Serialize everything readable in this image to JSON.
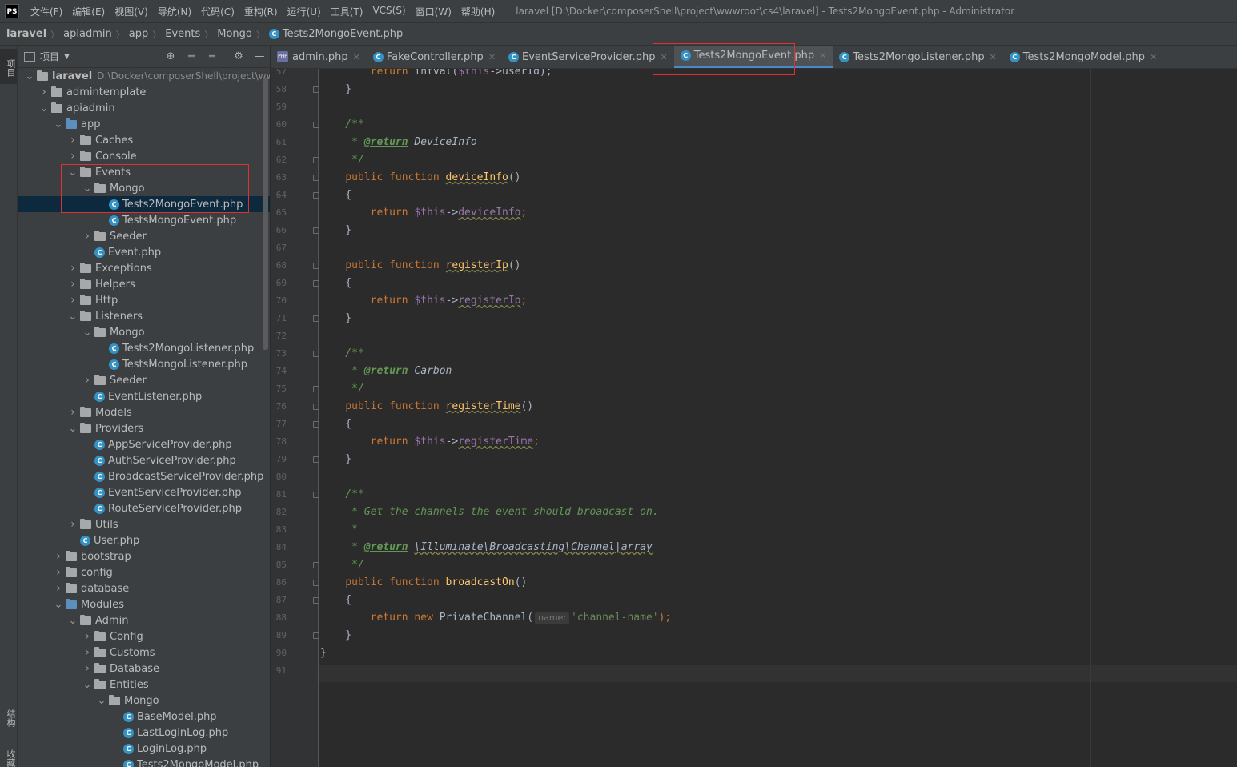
{
  "menubar": {
    "logo": "PS",
    "items": [
      "文件(F)",
      "编辑(E)",
      "视图(V)",
      "导航(N)",
      "代码(C)",
      "重构(R)",
      "运行(U)",
      "工具(T)",
      "VCS(S)",
      "窗口(W)",
      "帮助(H)"
    ],
    "window_title": "laravel [D:\\Docker\\composerShell\\project\\wwwroot\\cs4\\laravel] - Tests2MongoEvent.php - Administrator"
  },
  "breadcrumb": [
    "laravel",
    "apiadmin",
    "app",
    "Events",
    "Mongo",
    "Tests2MongoEvent.php"
  ],
  "left_strip": {
    "project_tab": "项目",
    "structure_tab": "结构",
    "favorites_tab": "收藏"
  },
  "project_panel": {
    "title": "项目",
    "root_hint": "D:\\Docker\\composerShell\\project\\wwwroot",
    "tree": [
      {
        "label": "laravel",
        "depth": 0,
        "type": "folder",
        "expanded": true,
        "bold": true
      },
      {
        "label": "admintemplate",
        "depth": 1,
        "type": "folder",
        "expanded": false
      },
      {
        "label": "apiadmin",
        "depth": 1,
        "type": "folder",
        "expanded": true
      },
      {
        "label": "app",
        "depth": 2,
        "type": "folder-blue",
        "expanded": true
      },
      {
        "label": "Caches",
        "depth": 3,
        "type": "folder",
        "expanded": false
      },
      {
        "label": "Console",
        "depth": 3,
        "type": "folder",
        "expanded": false
      },
      {
        "label": "Events",
        "depth": 3,
        "type": "folder",
        "expanded": true
      },
      {
        "label": "Mongo",
        "depth": 4,
        "type": "folder",
        "expanded": true
      },
      {
        "label": "Tests2MongoEvent.php",
        "depth": 5,
        "type": "class",
        "selected": true
      },
      {
        "label": "TestsMongoEvent.php",
        "depth": 5,
        "type": "class"
      },
      {
        "label": "Seeder",
        "depth": 4,
        "type": "folder",
        "expanded": false
      },
      {
        "label": "Event.php",
        "depth": 4,
        "type": "class"
      },
      {
        "label": "Exceptions",
        "depth": 3,
        "type": "folder",
        "expanded": false
      },
      {
        "label": "Helpers",
        "depth": 3,
        "type": "folder",
        "expanded": false
      },
      {
        "label": "Http",
        "depth": 3,
        "type": "folder",
        "expanded": false
      },
      {
        "label": "Listeners",
        "depth": 3,
        "type": "folder",
        "expanded": true
      },
      {
        "label": "Mongo",
        "depth": 4,
        "type": "folder",
        "expanded": true
      },
      {
        "label": "Tests2MongoListener.php",
        "depth": 5,
        "type": "class"
      },
      {
        "label": "TestsMongoListener.php",
        "depth": 5,
        "type": "class"
      },
      {
        "label": "Seeder",
        "depth": 4,
        "type": "folder",
        "expanded": false
      },
      {
        "label": "EventListener.php",
        "depth": 4,
        "type": "class"
      },
      {
        "label": "Models",
        "depth": 3,
        "type": "folder",
        "expanded": false
      },
      {
        "label": "Providers",
        "depth": 3,
        "type": "folder",
        "expanded": true
      },
      {
        "label": "AppServiceProvider.php",
        "depth": 4,
        "type": "class"
      },
      {
        "label": "AuthServiceProvider.php",
        "depth": 4,
        "type": "class"
      },
      {
        "label": "BroadcastServiceProvider.php",
        "depth": 4,
        "type": "class"
      },
      {
        "label": "EventServiceProvider.php",
        "depth": 4,
        "type": "class"
      },
      {
        "label": "RouteServiceProvider.php",
        "depth": 4,
        "type": "class"
      },
      {
        "label": "Utils",
        "depth": 3,
        "type": "folder",
        "expanded": false
      },
      {
        "label": "User.php",
        "depth": 3,
        "type": "class"
      },
      {
        "label": "bootstrap",
        "depth": 2,
        "type": "folder",
        "expanded": false
      },
      {
        "label": "config",
        "depth": 2,
        "type": "folder",
        "expanded": false
      },
      {
        "label": "database",
        "depth": 2,
        "type": "folder",
        "expanded": false
      },
      {
        "label": "Modules",
        "depth": 2,
        "type": "folder-blue",
        "expanded": true
      },
      {
        "label": "Admin",
        "depth": 3,
        "type": "folder",
        "expanded": true
      },
      {
        "label": "Config",
        "depth": 4,
        "type": "folder",
        "expanded": false
      },
      {
        "label": "Customs",
        "depth": 4,
        "type": "folder",
        "expanded": false
      },
      {
        "label": "Database",
        "depth": 4,
        "type": "folder",
        "expanded": false
      },
      {
        "label": "Entities",
        "depth": 4,
        "type": "folder",
        "expanded": true
      },
      {
        "label": "Mongo",
        "depth": 5,
        "type": "folder",
        "expanded": true
      },
      {
        "label": "BaseModel.php",
        "depth": 6,
        "type": "class"
      },
      {
        "label": "LastLoginLog.php",
        "depth": 6,
        "type": "class"
      },
      {
        "label": "LoginLog.php",
        "depth": 6,
        "type": "class"
      },
      {
        "label": "Tests2MongoModel.php",
        "depth": 6,
        "type": "class"
      }
    ]
  },
  "tabs": [
    {
      "label": "admin.php",
      "icon": "php-file-icon",
      "active": false
    },
    {
      "label": "FakeController.php",
      "icon": "class-icon",
      "active": false
    },
    {
      "label": "EventServiceProvider.php",
      "icon": "class-icon",
      "active": false
    },
    {
      "label": "Tests2MongoEvent.php",
      "icon": "class-icon",
      "active": true
    },
    {
      "label": "Tests2MongoListener.php",
      "icon": "class-icon",
      "active": false
    },
    {
      "label": "Tests2MongoModel.php",
      "icon": "class-icon",
      "active": false
    }
  ],
  "editor": {
    "line_numbers": [
      57,
      58,
      59,
      60,
      61,
      62,
      63,
      64,
      65,
      66,
      67,
      68,
      69,
      70,
      71,
      72,
      73,
      74,
      75,
      76,
      77,
      78,
      79,
      80,
      81,
      82,
      83,
      84,
      85,
      86,
      87,
      88,
      89,
      90,
      91
    ],
    "lines": [
      [
        {
          "t": "        ",
          "c": ""
        },
        {
          "t": "return ",
          "c": "kw"
        },
        {
          "t": "intval(",
          "c": ""
        },
        {
          "t": "$this",
          "c": "var"
        },
        {
          "t": "->userId);",
          "c": ""
        }
      ],
      [
        {
          "t": "    }",
          "c": ""
        }
      ],
      [],
      [
        {
          "t": "    /**",
          "c": "doc"
        }
      ],
      [
        {
          "t": "     * ",
          "c": "doc"
        },
        {
          "t": "@return",
          "c": "doctag"
        },
        {
          "t": " DeviceInfo",
          "c": "doctype"
        }
      ],
      [
        {
          "t": "     */",
          "c": "doc"
        }
      ],
      [
        {
          "t": "    ",
          "c": ""
        },
        {
          "t": "public function ",
          "c": "kw"
        },
        {
          "t": "deviceInfo",
          "c": "fn"
        },
        {
          "t": "()",
          "c": ""
        }
      ],
      [
        {
          "t": "    {",
          "c": ""
        }
      ],
      [
        {
          "t": "        ",
          "c": ""
        },
        {
          "t": "return ",
          "c": "kw"
        },
        {
          "t": "$this",
          "c": "var"
        },
        {
          "t": "->",
          "c": ""
        },
        {
          "t": "deviceInfo",
          "c": "prop-ul"
        },
        {
          "t": ";",
          "c": "kw"
        }
      ],
      [
        {
          "t": "    }",
          "c": ""
        }
      ],
      [],
      [
        {
          "t": "    ",
          "c": ""
        },
        {
          "t": "public function ",
          "c": "kw"
        },
        {
          "t": "registerIp",
          "c": "fn"
        },
        {
          "t": "()",
          "c": ""
        }
      ],
      [
        {
          "t": "    {",
          "c": ""
        }
      ],
      [
        {
          "t": "        ",
          "c": ""
        },
        {
          "t": "return ",
          "c": "kw"
        },
        {
          "t": "$this",
          "c": "var"
        },
        {
          "t": "->",
          "c": ""
        },
        {
          "t": "registerIp",
          "c": "prop-ul"
        },
        {
          "t": ";",
          "c": "kw"
        }
      ],
      [
        {
          "t": "    }",
          "c": ""
        }
      ],
      [],
      [
        {
          "t": "    /**",
          "c": "doc"
        }
      ],
      [
        {
          "t": "     * ",
          "c": "doc"
        },
        {
          "t": "@return",
          "c": "doctag"
        },
        {
          "t": " Carbon",
          "c": "doctype"
        }
      ],
      [
        {
          "t": "     */",
          "c": "doc"
        }
      ],
      [
        {
          "t": "    ",
          "c": ""
        },
        {
          "t": "public function ",
          "c": "kw"
        },
        {
          "t": "registerTime",
          "c": "fn"
        },
        {
          "t": "()",
          "c": ""
        }
      ],
      [
        {
          "t": "    {",
          "c": ""
        }
      ],
      [
        {
          "t": "        ",
          "c": ""
        },
        {
          "t": "return ",
          "c": "kw"
        },
        {
          "t": "$this",
          "c": "var"
        },
        {
          "t": "->",
          "c": ""
        },
        {
          "t": "registerTime",
          "c": "prop-ul"
        },
        {
          "t": ";",
          "c": "kw"
        }
      ],
      [
        {
          "t": "    }",
          "c": ""
        }
      ],
      [],
      [
        {
          "t": "    /**",
          "c": "doc"
        }
      ],
      [
        {
          "t": "     * Get the channels the event should broadcast on.",
          "c": "doc"
        }
      ],
      [
        {
          "t": "     *",
          "c": "doc"
        }
      ],
      [
        {
          "t": "     * ",
          "c": "doc"
        },
        {
          "t": "@return",
          "c": "doctag"
        },
        {
          "t": " ",
          "c": "doc"
        },
        {
          "t": "\\Illuminate\\Broadcasting\\Channel|array",
          "c": "doctype-ul"
        }
      ],
      [
        {
          "t": "     */",
          "c": "doc"
        }
      ],
      [
        {
          "t": "    ",
          "c": ""
        },
        {
          "t": "public function ",
          "c": "kw"
        },
        {
          "t": "broadcastOn",
          "c": "fn-plain"
        },
        {
          "t": "()",
          "c": ""
        }
      ],
      [
        {
          "t": "    {",
          "c": ""
        }
      ],
      [
        {
          "t": "        ",
          "c": ""
        },
        {
          "t": "return new ",
          "c": "kw"
        },
        {
          "t": "PrivateChannel(",
          "c": ""
        },
        {
          "t": "name:",
          "c": "hint"
        },
        {
          "t": "'channel-name'",
          "c": "str"
        },
        {
          "t": ");",
          "c": "kw"
        }
      ],
      [
        {
          "t": "    }",
          "c": ""
        }
      ],
      [
        {
          "t": "}",
          "c": ""
        }
      ],
      []
    ]
  },
  "colors": {
    "accent": "#4a88c7",
    "annotation_red": "#e03030",
    "selection": "#0d293e"
  }
}
